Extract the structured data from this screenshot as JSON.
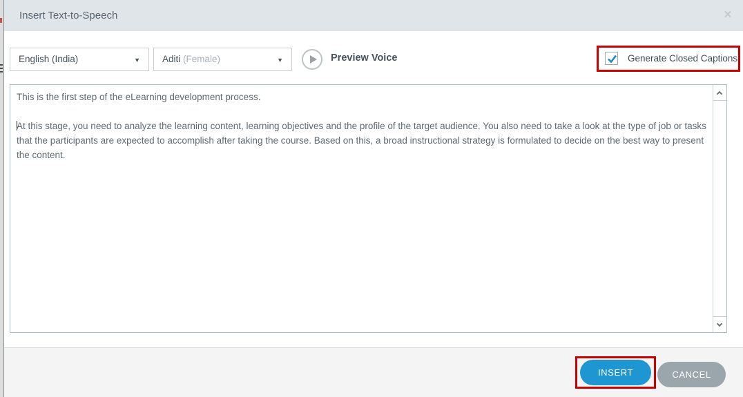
{
  "dialog": {
    "title": "Insert Text-to-Speech"
  },
  "icons": {
    "close": "✕",
    "dropdown_arrow": "▼"
  },
  "voice_controls": {
    "language_dropdown": {
      "value": "English (India)"
    },
    "voice_dropdown": {
      "value": "Aditi",
      "value_detail": " (Female)"
    },
    "preview_label": "Preview Voice",
    "captions_checkbox": {
      "label": "Generate Closed Captions",
      "checked": true
    }
  },
  "editor": {
    "paragraph1": "This is the first step of the eLearning development process.",
    "paragraph2": "At this stage, you need to analyze the learning content, learning objectives and the profile of the target audience. You also need to take a look at the type of job or tasks that the participants are expected to accomplish after taking the course. Based on this, a broad instructional strategy is formulated to decide on the best way to present the content."
  },
  "footer": {
    "insert_label": "INSERT",
    "cancel_label": "CANCEL"
  },
  "colors": {
    "accent_blue": "#1e96d2",
    "cancel_gray": "#9ba5ac",
    "annotation_red": "#c80000",
    "titlebar_bg": "#dfe5e9",
    "checkmark_blue": "#1d87c8"
  }
}
